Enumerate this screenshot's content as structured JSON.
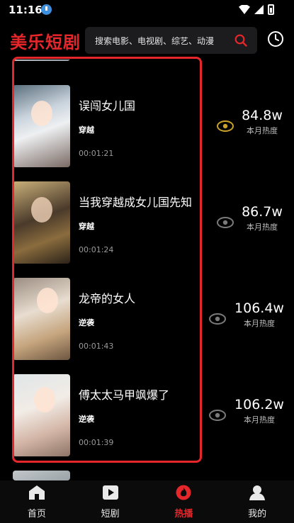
{
  "status_bar": {
    "time": "11:16"
  },
  "header": {
    "logo": "美乐短剧",
    "search_placeholder": "搜索电影、电视剧、综艺、动漫"
  },
  "colors": {
    "accent": "#e5262b",
    "background": "#000000",
    "eye_active": "#c9a227"
  },
  "list": [
    {
      "title": "误闯女儿国",
      "tag": "穿越",
      "duration": "00:01:21",
      "heat": "84.8w",
      "heat_label": "本月热度",
      "eye_active": true
    },
    {
      "title": "当我穿越成女儿国先知",
      "tag": "穿越",
      "duration": "00:01:24",
      "heat": "86.7w",
      "heat_label": "本月热度",
      "eye_active": false
    },
    {
      "title": "龙帝的女人",
      "tag": "逆袭",
      "duration": "00:01:43",
      "heat": "106.4w",
      "heat_label": "本月热度",
      "eye_active": false
    },
    {
      "title": "傅太太马甲飒爆了",
      "tag": "逆袭",
      "duration": "00:01:39",
      "heat": "106.2w",
      "heat_label": "本月热度",
      "eye_active": false
    }
  ],
  "tabs": [
    {
      "label": "首页",
      "icon": "home-icon"
    },
    {
      "label": "短剧",
      "icon": "play-icon"
    },
    {
      "label": "热播",
      "icon": "fire-icon",
      "active": true
    },
    {
      "label": "我的",
      "icon": "user-icon"
    }
  ]
}
